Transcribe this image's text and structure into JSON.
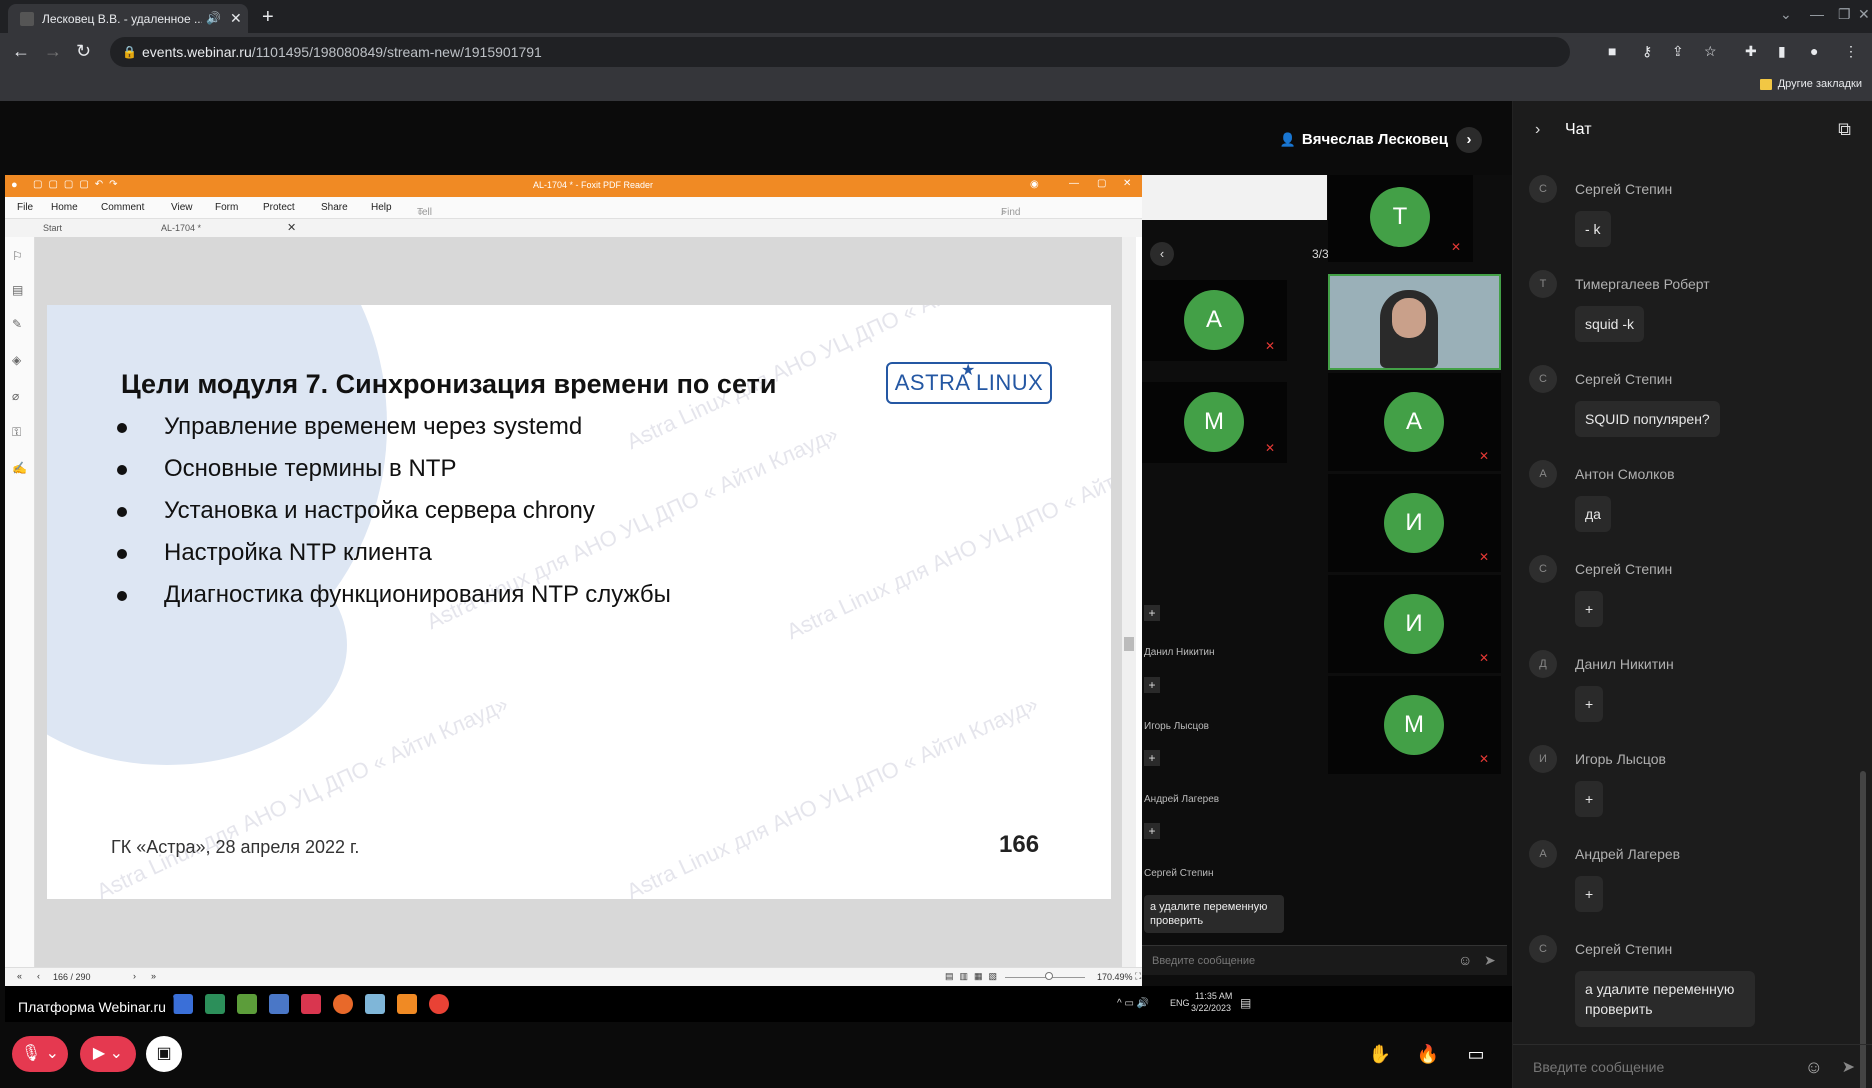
{
  "browser": {
    "tab_title": "Лесковец В.В. - удаленное ...",
    "url_host": "events.webinar.ru",
    "url_path": "/1101495/198080849/stream-new/1915901791",
    "bookmarks_label": "Другие закладки"
  },
  "webinar": {
    "speaker_name": "Вячеслав Лесковец",
    "platform_label": "Платформа Webinar.ru"
  },
  "foxit": {
    "window_title": "AL-1704 * - Foxit PDF Reader",
    "menu": [
      "File",
      "Home",
      "Comment",
      "View",
      "Form",
      "Protect",
      "Share",
      "Help"
    ],
    "tell_me": "Tell me...",
    "find": "Find",
    "tabs": [
      "Start",
      "AL-1704 *"
    ],
    "page_indicator": "166 / 290",
    "zoom": "170.49%"
  },
  "slide": {
    "title": "Цели модуля 7. Синхронизация времени по сети",
    "logo": "ASTRA LINUX",
    "bullets": [
      "Управление временем через systemd",
      "Основные термины в NTP",
      "Установка и настройка сервера chrony",
      "Настройка NTP клиента",
      "Диагностика функционирования NTP службы"
    ],
    "footer": "ГК «Астра», 28 апреля 2022 г.",
    "page_number": "166",
    "watermark": "Astra Linux для АНО УЦ ДПО « Айти Клауд»"
  },
  "inner_webinar": {
    "page_counter": "3/3",
    "tiles_left": [
      "А",
      "М"
    ],
    "tiles_right": [
      "Т",
      "А",
      "И",
      "И",
      "М"
    ],
    "chat_names": [
      "Данил Никитин",
      "Игорь Лысцов",
      "Андрей Лагерев",
      "Сергей Степин"
    ],
    "last_message": "а удалите переменную проверить",
    "input_placeholder": "Введите сообщение",
    "tray_lang": "ENG",
    "tray_time": "11:35 AM",
    "tray_date": "3/22/2023"
  },
  "chat": {
    "title": "Чат",
    "messages": [
      {
        "initial": "С",
        "author": "Сергей Степин",
        "text": "- k"
      },
      {
        "initial": "Т",
        "author": "Тимергалеев Роберт",
        "text": "squid -k"
      },
      {
        "initial": "С",
        "author": "Сергей Степин",
        "text": "SQUID популярен?"
      },
      {
        "initial": "А",
        "author": "Антон Смолков",
        "text": "да"
      },
      {
        "initial": "С",
        "author": "Сергей Степин",
        "text": "+"
      },
      {
        "initial": "Д",
        "author": "Данил Никитин",
        "text": "+"
      },
      {
        "initial": "И",
        "author": "Игорь Лысцов",
        "text": "+"
      },
      {
        "initial": "А",
        "author": "Андрей Лагерев",
        "text": "+"
      },
      {
        "initial": "С",
        "author": "Сергей Степин",
        "text": "а удалите переменную проверить"
      }
    ],
    "input_placeholder": "Введите сообщение"
  },
  "colors": {
    "foxit_title": "#f08a24",
    "avatar_green": "#43a047",
    "mute_red": "#e53935",
    "astra_blue": "#2457a3"
  }
}
